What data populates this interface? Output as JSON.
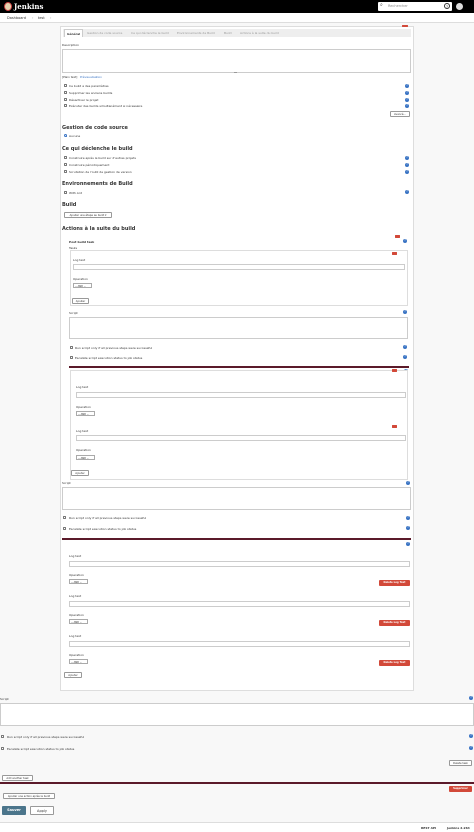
{
  "header": {
    "brand": "Jenkins",
    "search_placeholder": "Rechercher",
    "help": "?"
  },
  "breadcrumb": [
    "Dashboard",
    "test"
  ],
  "tabs": [
    "Général",
    "Gestion de code source",
    "Ce qui déclenche le build",
    "Environnements de Build",
    "Build",
    "Actions à la suite du build"
  ],
  "general": {
    "description_label": "Description",
    "plain_text": "[Plain text]",
    "preview": "Prévisualisation",
    "options": [
      "Ce build a des paramètres",
      "Supprimer les anciens builds",
      "Désactiver le projet",
      "Exécuter des builds simultanément si nécessaire"
    ],
    "advanced_button": "Avancé..."
  },
  "scm": {
    "title": "Gestion de code source",
    "none": "Aucune"
  },
  "triggers": {
    "title": "Ce qui déclenche le build",
    "options": [
      "Construire après le build sur d'autres projets",
      "Construire périodiquement",
      "Scrutation de l'outil de gestion de version"
    ]
  },
  "build_env": {
    "title": "Environnements de Build",
    "options": [
      "With Ant"
    ]
  },
  "build": {
    "title": "Build",
    "add_step": "Ajouter une étape au build ▾"
  },
  "post_build": {
    "title": "Actions à la suite du build",
    "post_build_task": "Post build task",
    "tasks_label": "Tasks",
    "log_text": "Log text",
    "operation": "Operation",
    "operation_value": "-- AND --",
    "add": "Ajouter",
    "script": "Script",
    "run_if_success": "Run script only if all previous steps were successful",
    "escalate": "Escalate script execution status to job status",
    "delete_log_text": "Delete Log Text",
    "delete_task": "Delete task",
    "add_another_task": "Add another task",
    "supprimer": "Supprimer",
    "add_post_build": "Ajouter une action après le build"
  },
  "actions": {
    "save": "Sauver",
    "apply": "Apply"
  },
  "footer": {
    "rest_api": "REST API",
    "version": "Jenkins 2.264"
  },
  "colors": {
    "header_bg": "#000000",
    "primary": "#4b758b",
    "danger": "#d24939",
    "help": "#3a74c4"
  }
}
